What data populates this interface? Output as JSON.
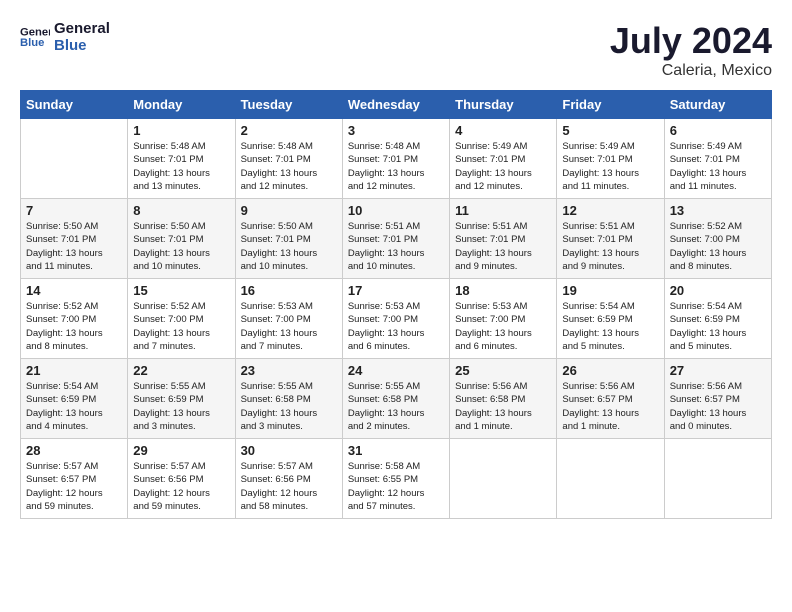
{
  "header": {
    "logo_line1": "General",
    "logo_line2": "Blue",
    "month_year": "July 2024",
    "location": "Caleria, Mexico"
  },
  "days_of_week": [
    "Sunday",
    "Monday",
    "Tuesday",
    "Wednesday",
    "Thursday",
    "Friday",
    "Saturday"
  ],
  "weeks": [
    [
      {
        "day": null,
        "info": null
      },
      {
        "day": "1",
        "info": "Sunrise: 5:48 AM\nSunset: 7:01 PM\nDaylight: 13 hours\nand 13 minutes."
      },
      {
        "day": "2",
        "info": "Sunrise: 5:48 AM\nSunset: 7:01 PM\nDaylight: 13 hours\nand 12 minutes."
      },
      {
        "day": "3",
        "info": "Sunrise: 5:48 AM\nSunset: 7:01 PM\nDaylight: 13 hours\nand 12 minutes."
      },
      {
        "day": "4",
        "info": "Sunrise: 5:49 AM\nSunset: 7:01 PM\nDaylight: 13 hours\nand 12 minutes."
      },
      {
        "day": "5",
        "info": "Sunrise: 5:49 AM\nSunset: 7:01 PM\nDaylight: 13 hours\nand 11 minutes."
      },
      {
        "day": "6",
        "info": "Sunrise: 5:49 AM\nSunset: 7:01 PM\nDaylight: 13 hours\nand 11 minutes."
      }
    ],
    [
      {
        "day": "7",
        "info": "Sunrise: 5:50 AM\nSunset: 7:01 PM\nDaylight: 13 hours\nand 11 minutes."
      },
      {
        "day": "8",
        "info": "Sunrise: 5:50 AM\nSunset: 7:01 PM\nDaylight: 13 hours\nand 10 minutes."
      },
      {
        "day": "9",
        "info": "Sunrise: 5:50 AM\nSunset: 7:01 PM\nDaylight: 13 hours\nand 10 minutes."
      },
      {
        "day": "10",
        "info": "Sunrise: 5:51 AM\nSunset: 7:01 PM\nDaylight: 13 hours\nand 10 minutes."
      },
      {
        "day": "11",
        "info": "Sunrise: 5:51 AM\nSunset: 7:01 PM\nDaylight: 13 hours\nand 9 minutes."
      },
      {
        "day": "12",
        "info": "Sunrise: 5:51 AM\nSunset: 7:01 PM\nDaylight: 13 hours\nand 9 minutes."
      },
      {
        "day": "13",
        "info": "Sunrise: 5:52 AM\nSunset: 7:00 PM\nDaylight: 13 hours\nand 8 minutes."
      }
    ],
    [
      {
        "day": "14",
        "info": "Sunrise: 5:52 AM\nSunset: 7:00 PM\nDaylight: 13 hours\nand 8 minutes."
      },
      {
        "day": "15",
        "info": "Sunrise: 5:52 AM\nSunset: 7:00 PM\nDaylight: 13 hours\nand 7 minutes."
      },
      {
        "day": "16",
        "info": "Sunrise: 5:53 AM\nSunset: 7:00 PM\nDaylight: 13 hours\nand 7 minutes."
      },
      {
        "day": "17",
        "info": "Sunrise: 5:53 AM\nSunset: 7:00 PM\nDaylight: 13 hours\nand 6 minutes."
      },
      {
        "day": "18",
        "info": "Sunrise: 5:53 AM\nSunset: 7:00 PM\nDaylight: 13 hours\nand 6 minutes."
      },
      {
        "day": "19",
        "info": "Sunrise: 5:54 AM\nSunset: 6:59 PM\nDaylight: 13 hours\nand 5 minutes."
      },
      {
        "day": "20",
        "info": "Sunrise: 5:54 AM\nSunset: 6:59 PM\nDaylight: 13 hours\nand 5 minutes."
      }
    ],
    [
      {
        "day": "21",
        "info": "Sunrise: 5:54 AM\nSunset: 6:59 PM\nDaylight: 13 hours\nand 4 minutes."
      },
      {
        "day": "22",
        "info": "Sunrise: 5:55 AM\nSunset: 6:59 PM\nDaylight: 13 hours\nand 3 minutes."
      },
      {
        "day": "23",
        "info": "Sunrise: 5:55 AM\nSunset: 6:58 PM\nDaylight: 13 hours\nand 3 minutes."
      },
      {
        "day": "24",
        "info": "Sunrise: 5:55 AM\nSunset: 6:58 PM\nDaylight: 13 hours\nand 2 minutes."
      },
      {
        "day": "25",
        "info": "Sunrise: 5:56 AM\nSunset: 6:58 PM\nDaylight: 13 hours\nand 1 minute."
      },
      {
        "day": "26",
        "info": "Sunrise: 5:56 AM\nSunset: 6:57 PM\nDaylight: 13 hours\nand 1 minute."
      },
      {
        "day": "27",
        "info": "Sunrise: 5:56 AM\nSunset: 6:57 PM\nDaylight: 13 hours\nand 0 minutes."
      }
    ],
    [
      {
        "day": "28",
        "info": "Sunrise: 5:57 AM\nSunset: 6:57 PM\nDaylight: 12 hours\nand 59 minutes."
      },
      {
        "day": "29",
        "info": "Sunrise: 5:57 AM\nSunset: 6:56 PM\nDaylight: 12 hours\nand 59 minutes."
      },
      {
        "day": "30",
        "info": "Sunrise: 5:57 AM\nSunset: 6:56 PM\nDaylight: 12 hours\nand 58 minutes."
      },
      {
        "day": "31",
        "info": "Sunrise: 5:58 AM\nSunset: 6:55 PM\nDaylight: 12 hours\nand 57 minutes."
      },
      {
        "day": null,
        "info": null
      },
      {
        "day": null,
        "info": null
      },
      {
        "day": null,
        "info": null
      }
    ]
  ]
}
